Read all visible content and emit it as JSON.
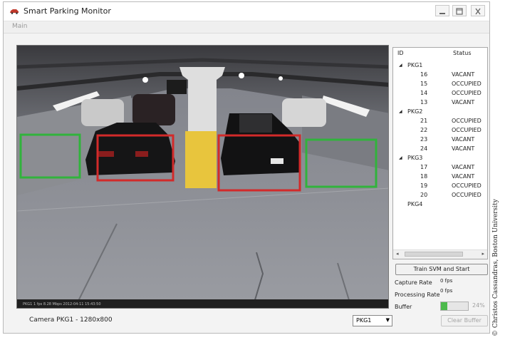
{
  "window": {
    "title": "Smart Parking Monitor",
    "menu": [
      "Main"
    ],
    "controls": [
      "minimize-icon",
      "maximize-icon",
      "close-icon"
    ]
  },
  "camera": {
    "overlay_text": "PKG1 1 fps 8.28 Mbps 2012-04-11 15:43:50",
    "label": "Camera PKG1 - 1280x800",
    "zone_colors": {
      "vacant": "#31b33c",
      "occupied": "#d22a2a"
    },
    "zones": [
      {
        "id": "16",
        "status": "VACANT"
      },
      {
        "id": "15",
        "status": "OCCUPIED"
      },
      {
        "id": "14",
        "status": "OCCUPIED"
      },
      {
        "id": "13",
        "status": "VACANT"
      }
    ]
  },
  "camera_select": {
    "selected": "PKG1"
  },
  "tree": {
    "headers": {
      "id": "ID",
      "status": "Status"
    },
    "groups": [
      {
        "name": "PKG1",
        "spots": [
          {
            "id": "16",
            "status": "VACANT"
          },
          {
            "id": "15",
            "status": "OCCUPIED"
          },
          {
            "id": "14",
            "status": "OCCUPIED"
          },
          {
            "id": "13",
            "status": "VACANT"
          }
        ]
      },
      {
        "name": "PKG2",
        "spots": [
          {
            "id": "21",
            "status": "OCCUPIED"
          },
          {
            "id": "22",
            "status": "OCCUPIED"
          },
          {
            "id": "23",
            "status": "VACANT"
          },
          {
            "id": "24",
            "status": "VACANT"
          }
        ]
      },
      {
        "name": "PKG3",
        "spots": [
          {
            "id": "17",
            "status": "VACANT"
          },
          {
            "id": "18",
            "status": "VACANT"
          },
          {
            "id": "19",
            "status": "OCCUPIED"
          },
          {
            "id": "20",
            "status": "OCCUPIED"
          }
        ]
      },
      {
        "name": "PKG4",
        "spots": []
      }
    ]
  },
  "controls": {
    "train_label": "Train SVM and Start",
    "capture_label": "Capture Rate",
    "capture_value": "0 fps",
    "processing_label": "Processing Rate",
    "processing_value": "0 fps",
    "buffer_label": "Buffer",
    "buffer_level": 0.24,
    "buffer_text": "24%",
    "clear_label": "Clear Buffer"
  },
  "credit": "© Christos Cassandras, Boston University"
}
